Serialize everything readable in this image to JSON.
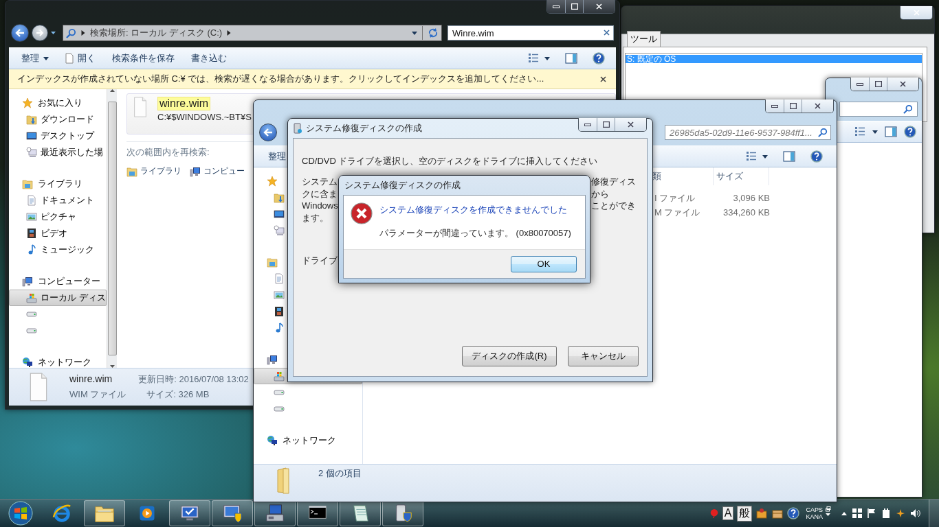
{
  "search_window": {
    "breadcrumb": "検索場所: ローカル ディスク (C:)",
    "search": {
      "value": "Winre.wim"
    },
    "toolbar": [
      {
        "label": "整理",
        "kind": "menu"
      },
      {
        "label": "開く",
        "kind": "open"
      },
      {
        "label": "検索条件を保存",
        "kind": "plain"
      },
      {
        "label": "書き込む",
        "kind": "plain"
      }
    ],
    "info_bar": "インデックスが作成されていない場所 C:¥ では、検索が遅くなる場合があります。クリックしてインデックスを追加してください...",
    "sidebar": [
      {
        "label": "お気に入り",
        "kind": "favorites",
        "selected": false,
        "children": [
          {
            "label": "ダウンロード",
            "kind": "downloads",
            "selected": false
          },
          {
            "label": "デスクトップ",
            "kind": "desktop",
            "selected": false
          },
          {
            "label": "最近表示した場",
            "kind": "recent",
            "selected": false
          }
        ]
      },
      {
        "label": "ライブラリ",
        "kind": "libraries",
        "selected": false,
        "children": [
          {
            "label": "ドキュメント",
            "kind": "documents",
            "selected": false
          },
          {
            "label": "ピクチャ",
            "kind": "pictures",
            "selected": false
          },
          {
            "label": "ビデオ",
            "kind": "videos",
            "selected": false
          },
          {
            "label": "ミュージック",
            "kind": "music",
            "selected": false
          }
        ]
      },
      {
        "label": "コンピューター",
        "kind": "computer",
        "selected": false,
        "children": [
          {
            "label": "ローカル ディス",
            "kind": "local-disk",
            "selected": true
          },
          {
            "kind": "drive",
            "selected": false
          },
          {
            "kind": "drive",
            "selected": false
          }
        ]
      },
      {
        "label": "ネットワーク",
        "kind": "network",
        "selected": false
      }
    ],
    "result": {
      "name": "winre.wim",
      "path": "C:¥$WINDOWS.~BT¥S"
    },
    "search_again": {
      "label": "次の範囲内を再検索:",
      "items": [
        {
          "label": "ライブラリ",
          "kind": "libraries"
        },
        {
          "label": "コンピュー",
          "kind": "computer"
        }
      ]
    },
    "details": {
      "name": "winre.wim",
      "type": "WIM ファイル",
      "modified": "更新日時: 2016/07/08 13:02",
      "size": "サイズ: 326 MB"
    }
  },
  "boot_window": {
    "tabs": [
      {
        "label": "ツール",
        "selected": false
      }
    ],
    "rows": [
      {
        "label": "S: 既定の OS",
        "selected": true
      }
    ]
  },
  "folder_window": {
    "search": {
      "placeholder": "26985da5-02d9-11e6-9537-984ff1..."
    },
    "toolbar": [
      {
        "label": "整理",
        "kind": "menu"
      }
    ],
    "sidebar": [
      {
        "kind": "favorites",
        "selected": false,
        "children": [
          {
            "kind": "downloads",
            "selected": false
          },
          {
            "kind": "desktop",
            "selected": false
          },
          {
            "kind": "recent",
            "selected": false
          }
        ]
      },
      {
        "kind": "libraries",
        "selected": false,
        "children": [
          {
            "kind": "documents",
            "selected": false
          },
          {
            "kind": "pictures",
            "selected": false
          },
          {
            "kind": "videos",
            "selected": false
          },
          {
            "kind": "music",
            "selected": false
          }
        ]
      },
      {
        "kind": "computer",
        "selected": false,
        "children": [
          {
            "kind": "local-disk",
            "selected": true
          },
          {
            "kind": "drive",
            "selected": false
          },
          {
            "kind": "drive",
            "selected": false
          }
        ]
      },
      {
        "label": "ネットワーク",
        "kind": "network",
        "selected": false
      }
    ],
    "columns": [
      "類",
      "サイズ"
    ],
    "rows": [
      {
        "type": "I ファイル",
        "size": "3,096 KB"
      },
      {
        "type": "M ファイル",
        "size": "334,260 KB"
      }
    ],
    "status": "2 個の項目"
  },
  "repair_dialog": {
    "title": "システム修復ディスクの作成",
    "instruction": "CD/DVD ドライブを選択し、空のディスクをドライブに挿入してください",
    "description": [
      {
        "left": "システム",
        "right": "修復ディス"
      },
      {
        "left": "クに含ま",
        "right": "から"
      },
      {
        "left": "Windows",
        "right": "ことができ"
      },
      {
        "left": "ます。"
      }
    ],
    "drive_label": "ドライブ",
    "buttons": [
      "ディスクの作成(R)",
      "キャンセル"
    ]
  },
  "error_dialog": {
    "title": "システム修復ディスクの作成",
    "heading": "システム修復ディスクを作成できませんでした",
    "message": "パラメーターが間違っています。 (0x80070057)",
    "button": "OK"
  },
  "taskbar": {
    "apps": [
      {
        "kind": "ie",
        "running": false
      },
      {
        "kind": "explorer",
        "running": true
      },
      {
        "kind": "media",
        "running": false
      },
      {
        "kind": "monitor-check",
        "running": true
      },
      {
        "kind": "monitor-shield",
        "running": true
      },
      {
        "kind": "computer-tools",
        "running": true
      },
      {
        "kind": "console",
        "running": true
      },
      {
        "kind": "notepad",
        "running": true
      },
      {
        "kind": "drive-shield",
        "running": true
      }
    ],
    "ime": {
      "mode": "A",
      "input": "般",
      "caps": "CAPS",
      "kana": "KANA"
    }
  }
}
